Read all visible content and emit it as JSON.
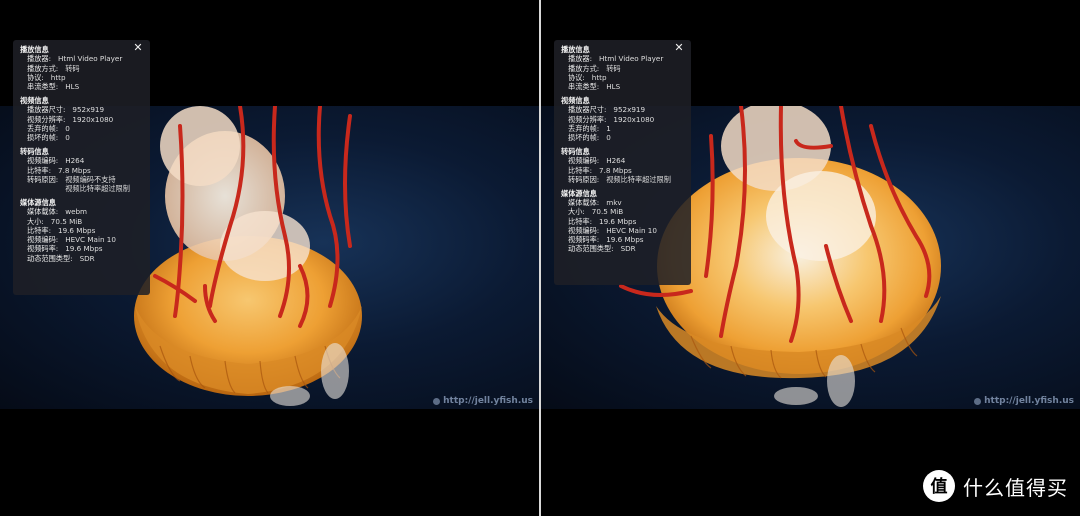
{
  "left_panel": {
    "sections": [
      {
        "title": "播放信息",
        "rows": [
          {
            "k": "播放器:",
            "v": [
              "Html Video Player"
            ]
          },
          {
            "k": "播放方式:",
            "v": [
              "转码"
            ]
          },
          {
            "k": "协议:",
            "v": [
              "http"
            ]
          },
          {
            "k": "串流类型:",
            "v": [
              "HLS"
            ]
          }
        ]
      },
      {
        "title": "视频信息",
        "rows": [
          {
            "k": "播放器尺寸:",
            "v": [
              "952x919"
            ]
          },
          {
            "k": "视频分辨率:",
            "v": [
              "1920x1080"
            ]
          },
          {
            "k": "丢弃的帧:",
            "v": [
              "0"
            ]
          },
          {
            "k": "损坏的帧:",
            "v": [
              "0"
            ]
          }
        ]
      },
      {
        "title": "转码信息",
        "rows": [
          {
            "k": "视频编码:",
            "v": [
              "H264"
            ]
          },
          {
            "k": "比特率:",
            "v": [
              "7.8 Mbps"
            ]
          },
          {
            "k": "转码原因:",
            "v": [
              "视频编码不支持",
              "视频比特率超过限制"
            ]
          }
        ]
      },
      {
        "title": "媒体源信息",
        "rows": [
          {
            "k": "媒体载体:",
            "v": [
              "webm"
            ]
          },
          {
            "k": "大小:",
            "v": [
              "70.5 MiB"
            ]
          },
          {
            "k": "比特率:",
            "v": [
              "19.6 Mbps"
            ]
          },
          {
            "k": "视频编码:",
            "v": [
              "HEVC Main 10"
            ]
          },
          {
            "k": "视频码率:",
            "v": [
              "19.6 Mbps"
            ]
          },
          {
            "k": "动态范围类型:",
            "v": [
              "SDR"
            ]
          }
        ]
      }
    ]
  },
  "right_panel": {
    "sections": [
      {
        "title": "播放信息",
        "rows": [
          {
            "k": "播放器:",
            "v": [
              "Html Video Player"
            ]
          },
          {
            "k": "播放方式:",
            "v": [
              "转码"
            ]
          },
          {
            "k": "协议:",
            "v": [
              "http"
            ]
          },
          {
            "k": "串流类型:",
            "v": [
              "HLS"
            ]
          }
        ]
      },
      {
        "title": "视频信息",
        "rows": [
          {
            "k": "播放器尺寸:",
            "v": [
              "952x919"
            ]
          },
          {
            "k": "视频分辨率:",
            "v": [
              "1920x1080"
            ]
          },
          {
            "k": "丢弃的帧:",
            "v": [
              "1"
            ]
          },
          {
            "k": "损坏的帧:",
            "v": [
              "0"
            ]
          }
        ]
      },
      {
        "title": "转码信息",
        "rows": [
          {
            "k": "视频编码:",
            "v": [
              "H264"
            ]
          },
          {
            "k": "比特率:",
            "v": [
              "7.8 Mbps"
            ]
          },
          {
            "k": "转码原因:",
            "v": [
              "视频比特率超过限制"
            ]
          }
        ]
      },
      {
        "title": "媒体源信息",
        "rows": [
          {
            "k": "媒体载体:",
            "v": [
              "mkv"
            ]
          },
          {
            "k": "大小:",
            "v": [
              "70.5 MiB"
            ]
          },
          {
            "k": "比特率:",
            "v": [
              "19.6 Mbps"
            ]
          },
          {
            "k": "视频编码:",
            "v": [
              "HEVC Main 10"
            ]
          },
          {
            "k": "视频码率:",
            "v": [
              "19.6 Mbps"
            ]
          },
          {
            "k": "动态范围类型:",
            "v": [
              "SDR"
            ]
          }
        ]
      }
    ]
  },
  "close_glyph": "✕",
  "watermark_text": "http://jell.yfish.us",
  "brand": {
    "logo_glyph": "值",
    "text": "什么值得买"
  },
  "colors": {
    "panel_bg": "#1e2026",
    "jelly_orange": "#f0a133",
    "tentacle_red": "#c8281c",
    "water": "#0b1a33"
  }
}
